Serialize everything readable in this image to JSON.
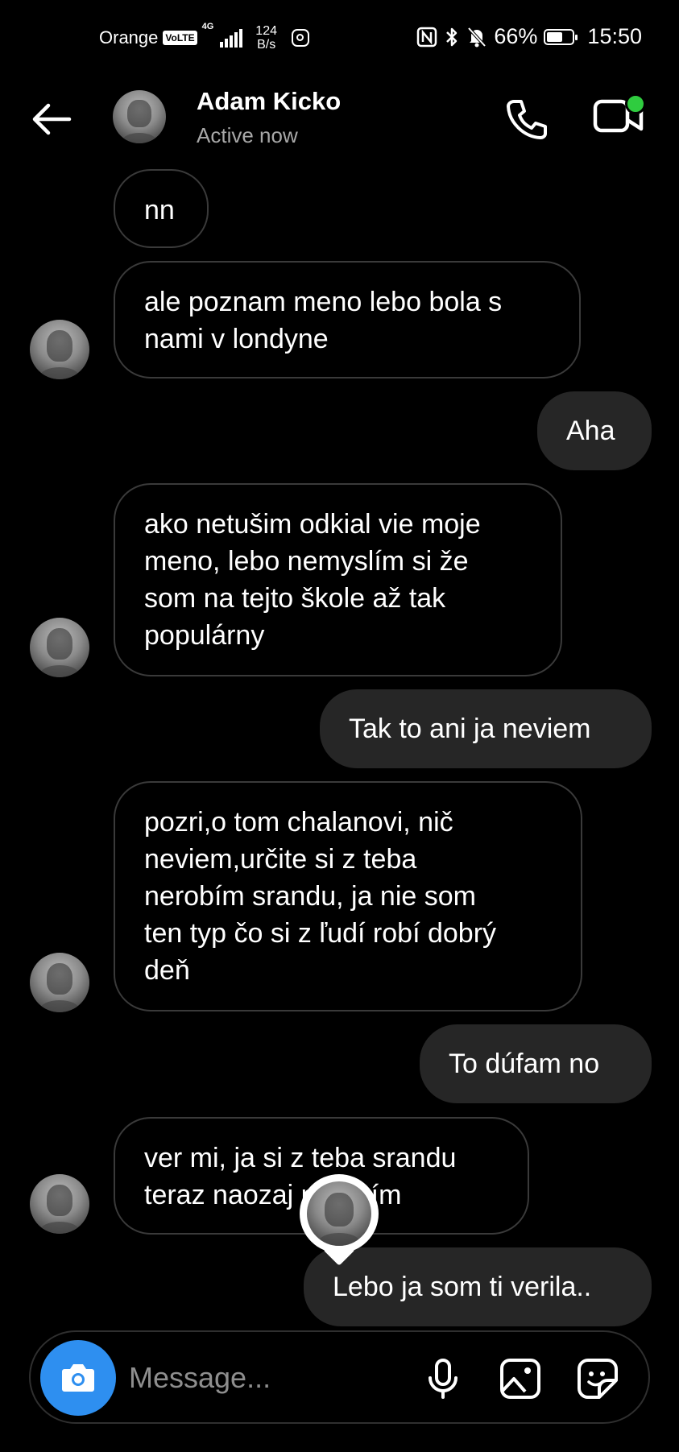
{
  "status_bar": {
    "carrier": "Orange",
    "volte": "VoLTE",
    "network": "4G",
    "speed_value": "124",
    "speed_unit": "B/s",
    "battery": "66%",
    "battery_level": 0.66,
    "time": "15:50"
  },
  "header": {
    "name": "Adam Kicko",
    "status": "Active now"
  },
  "messages": [
    {
      "side": "received",
      "text": "nn"
    },
    {
      "side": "received",
      "text": "ale poznam meno lebo bola s\nnami v londyne"
    },
    {
      "side": "sent",
      "text": "Aha"
    },
    {
      "side": "received",
      "text": "ako netušim odkial vie moje\nmeno, lebo nemyslím si že\nsom na tejto škole až tak\npopulárny"
    },
    {
      "side": "sent",
      "text": "Tak to ani ja neviem"
    },
    {
      "side": "received",
      "text": "pozri,o tom chalanovi, nič\nneviem,určite si z teba\nnerobím srandu, ja nie som\nten typ čo si z ľudí robí dobrý\ndeň"
    },
    {
      "side": "sent",
      "text": "To dúfam no"
    },
    {
      "side": "received",
      "text": "ver mi, ja si z teba srandu\nteraz naozaj nerobím"
    },
    {
      "side": "sent",
      "text": "Lebo ja som ti verila.."
    }
  ],
  "composer": {
    "placeholder": "Message..."
  },
  "icons": {
    "back": "arrow-left-icon",
    "call": "phone-icon",
    "video": "video-camera-icon",
    "camera": "camera-icon",
    "mic": "microphone-icon",
    "gallery": "image-icon",
    "sticker": "sticker-icon"
  },
  "colors": {
    "background": "#000000",
    "sent_bubble": "#262626",
    "received_border": "#3a3a3a",
    "accent_blue": "#2e8ff0",
    "online_green": "#2fcc3f",
    "secondary_text": "#a8a8a8"
  }
}
